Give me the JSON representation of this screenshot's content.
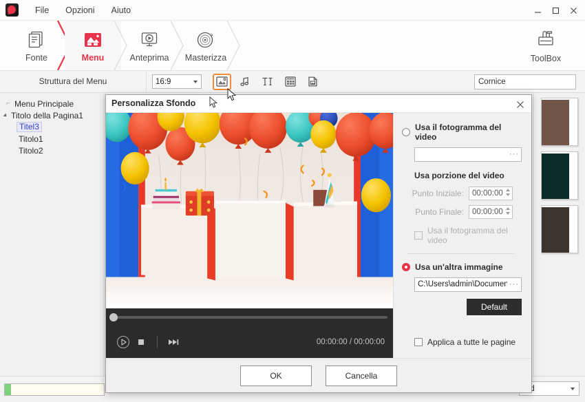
{
  "window": {
    "menus": [
      "File",
      "Opzioni",
      "Aiuto"
    ],
    "controls": {
      "minimize": "minimize-icon",
      "maximize": "maximize-icon",
      "close": "close-icon"
    },
    "logo": "app-logo-icon"
  },
  "ribbon": {
    "steps": [
      {
        "label": "Fonte",
        "icon": "document-stack-icon",
        "active": false
      },
      {
        "label": "Menu",
        "icon": "picture-menu-icon",
        "active": true
      },
      {
        "label": "Anteprima",
        "icon": "monitor-play-icon",
        "active": false
      },
      {
        "label": "Masterizza",
        "icon": "disc-burn-icon",
        "active": false
      }
    ],
    "toolbox": {
      "label": "ToolBox",
      "icon": "toolbox-icon"
    },
    "accent_color": "#e8334a"
  },
  "subbar": {
    "structure_label": "Struttura del Menu",
    "aspect_ratio": "16:9",
    "tools": [
      {
        "name": "background-image-tool",
        "icon": "image-icon",
        "selected": true
      },
      {
        "name": "background-music-tool",
        "icon": "music-note-icon",
        "selected": false
      },
      {
        "name": "text-tool",
        "icon": "text-icon",
        "selected": false
      },
      {
        "name": "thumbnail-grid-tool",
        "icon": "grid-icon",
        "selected": false
      },
      {
        "name": "page-template-tool",
        "icon": "page-icon",
        "selected": false
      }
    ],
    "frame_value": "Cornice",
    "highlight_color": "#f08a3c"
  },
  "tree": {
    "items": [
      {
        "label": "Menu Principale",
        "level": 1,
        "selected": false,
        "expandable": false
      },
      {
        "label": "Titolo della Pagina1",
        "level": 1,
        "selected": false,
        "expandable": true
      },
      {
        "label": "Titel3",
        "level": 2,
        "selected": true,
        "expandable": false
      },
      {
        "label": "Titolo1",
        "level": 2,
        "selected": false,
        "expandable": false
      },
      {
        "label": "Titolo2",
        "level": 2,
        "selected": false,
        "expandable": false
      }
    ]
  },
  "thumbnails": [
    {
      "name": "page-thumbnail-1",
      "color": "#71544a"
    },
    {
      "name": "page-thumbnail-2",
      "color": "#0c2b2b"
    },
    {
      "name": "page-thumbnail-3",
      "color": "#3e342e"
    }
  ],
  "statusbar": {
    "progress_percent": 6,
    "progress_fill_color": "#7fd07f",
    "burn_target": "ard"
  },
  "dialog": {
    "title": "Personalizza Sfondo",
    "close_icon": "close-icon",
    "preview": {
      "description": "Birthday scene with balloons and pedestals",
      "seek_position_percent": 0,
      "controls": [
        {
          "name": "play-button",
          "icon": "play-icon"
        },
        {
          "name": "stop-button",
          "icon": "stop-icon"
        },
        {
          "name": "next-frame-button",
          "icon": "next-icon"
        }
      ],
      "timecode": "00:00:00 / 00:00:00"
    },
    "use_video_frame": {
      "label": "Usa il fotogramma del video",
      "selected": false,
      "path_value": "",
      "browse_label": "···"
    },
    "use_video_portion": {
      "label": "Usa porzione del video",
      "start_label": "Punto Iniziale:",
      "start_value": "00:00:00",
      "end_label": "Punto Finale:",
      "end_value": "00:00:00",
      "checkbox_label": "Usa il fotogramma del video",
      "checkbox_checked": false
    },
    "use_other_image": {
      "label": "Usa un'altra immagine",
      "selected": true,
      "path_value": "C:\\Users\\admin\\Documents\\\\",
      "browse_label": "···"
    },
    "default_button": "Default",
    "apply_all": {
      "label": "Applica a tutte le pagine",
      "checked": false
    },
    "footer": {
      "ok": "OK",
      "cancel": "Cancella"
    }
  }
}
